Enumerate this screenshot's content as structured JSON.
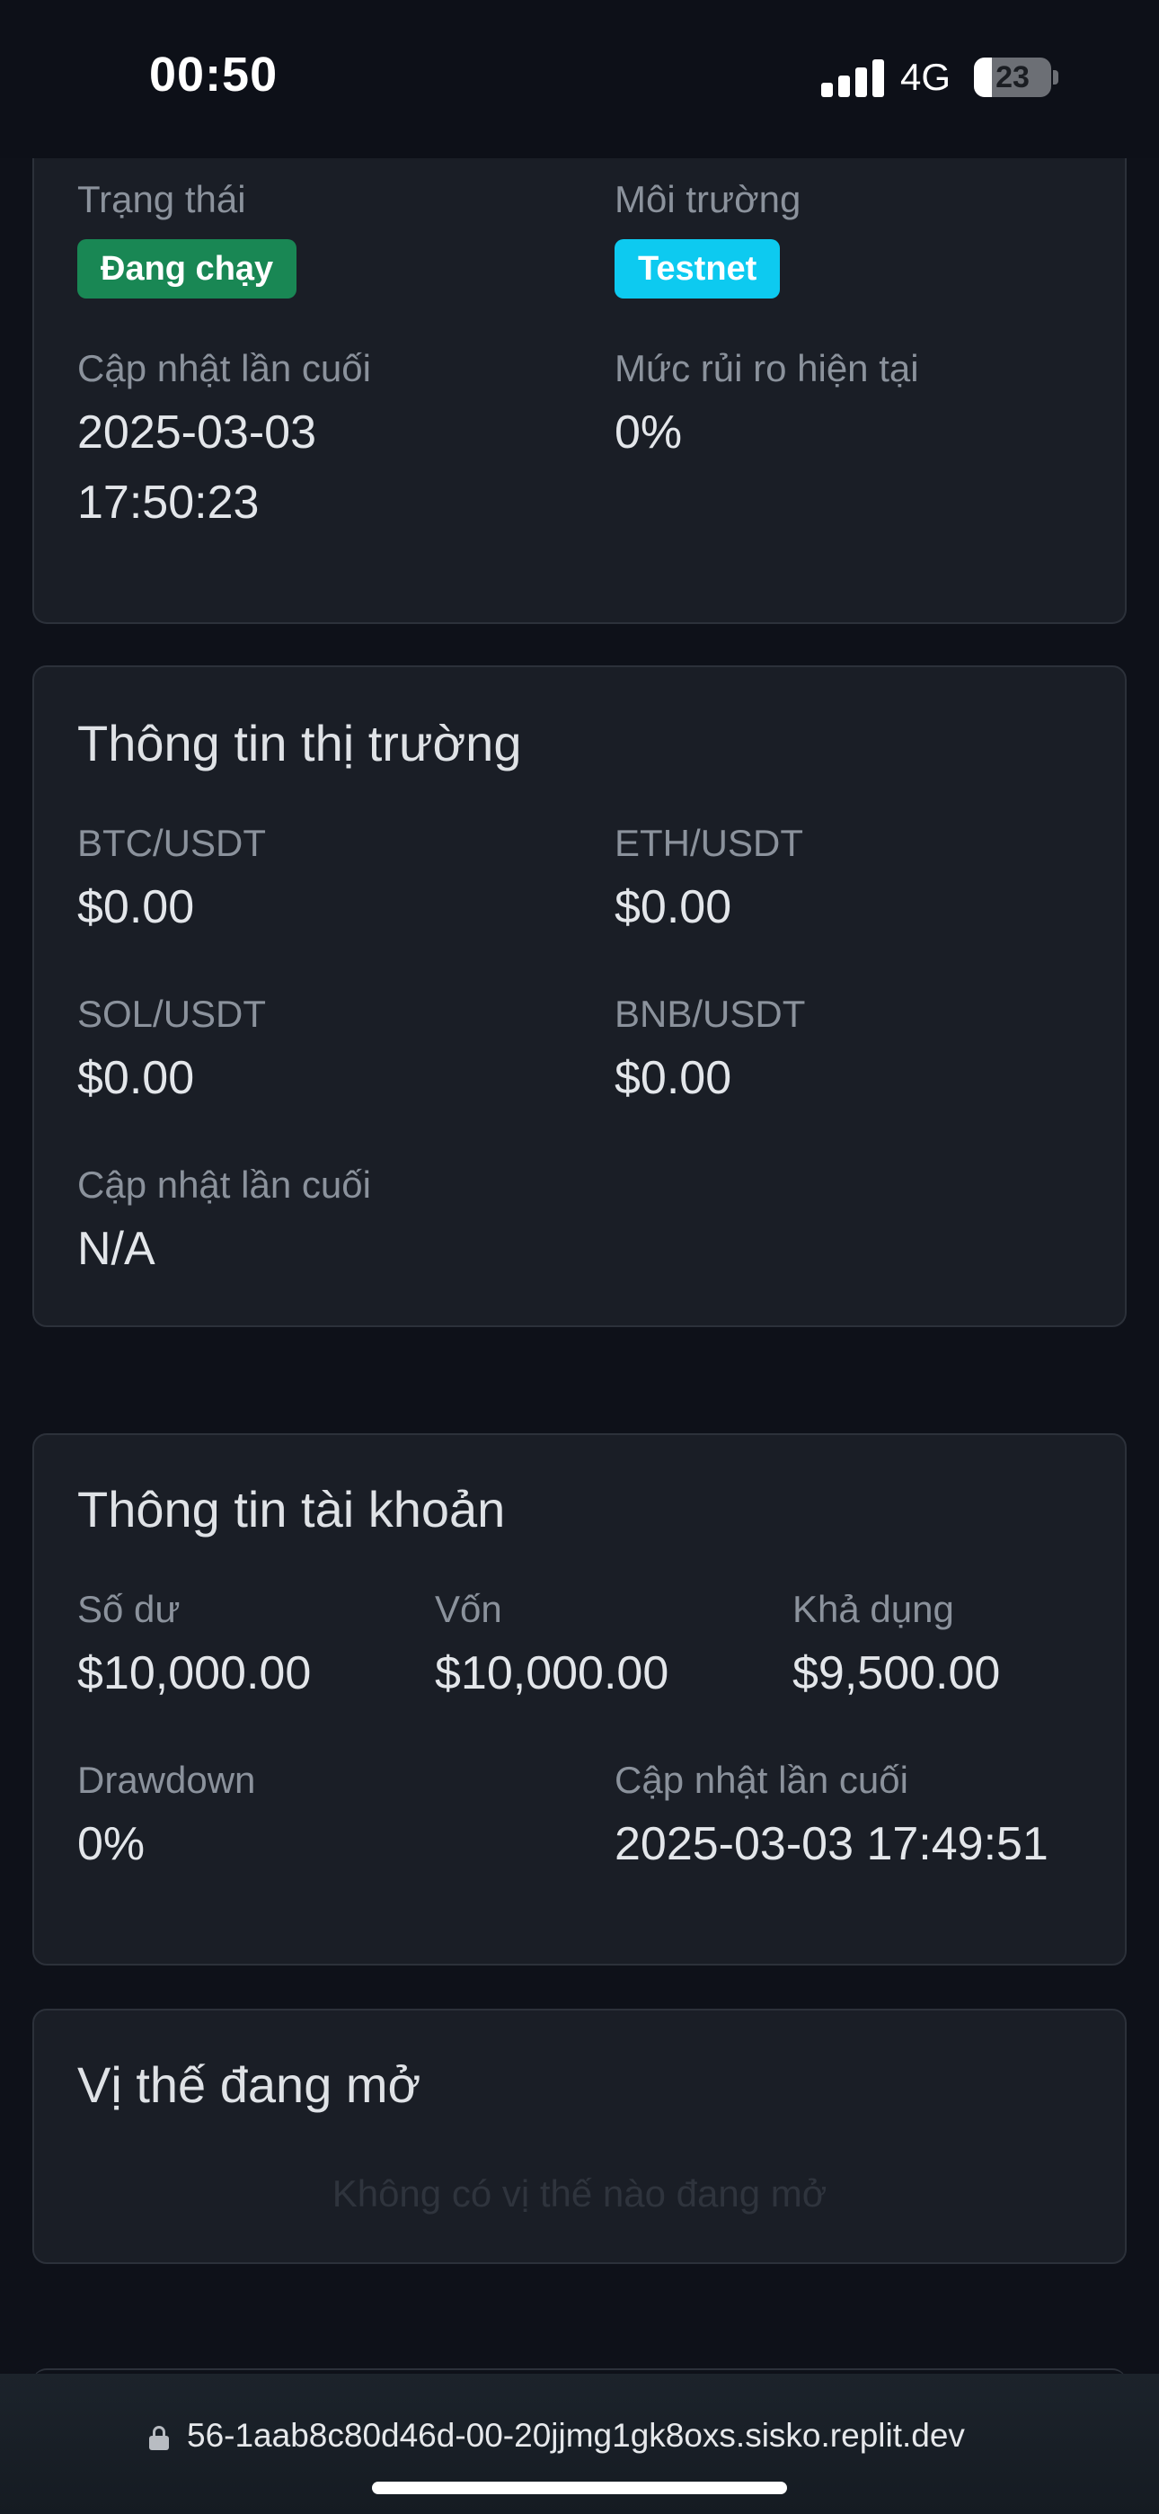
{
  "status_bar": {
    "time": "00:50",
    "network": "4G",
    "battery": "23",
    "battery_level": 0.23,
    "icons": [
      "signal-icon",
      "battery-icon"
    ]
  },
  "bot_status": {
    "status_label": "Trạng thái",
    "status_badge": "Đang chạy",
    "env_label": "Môi trường",
    "env_badge": "Testnet",
    "updated_label": "Cập nhật lần cuối",
    "updated_date": "2025-03-03",
    "updated_time": "17:50:23",
    "risk_label": "Mức rủi ro hiện tại",
    "risk_value": "0%",
    "colors": {
      "running": "#198754",
      "testnet": "#0dcaf0"
    }
  },
  "market": {
    "title": "Thông tin thị trường",
    "pairs": [
      {
        "symbol": "BTC/USDT",
        "price": "$0.00"
      },
      {
        "symbol": "ETH/USDT",
        "price": "$0.00"
      },
      {
        "symbol": "SOL/USDT",
        "price": "$0.00"
      },
      {
        "symbol": "BNB/USDT",
        "price": "$0.00"
      }
    ],
    "updated_label": "Cập nhật lần cuối",
    "updated_value": "N/A"
  },
  "account": {
    "title": "Thông tin tài khoản",
    "balance_label": "Số dư",
    "balance_value": "$10,000.00",
    "equity_label": "Vốn",
    "equity_value": "$10,000.00",
    "available_label": "Khả dụng",
    "available_value": "$9,500.00",
    "drawdown_label": "Drawdown",
    "drawdown_value": "0%",
    "updated_label": "Cập nhật lần cuối",
    "updated_value": "2025-03-03 17:49:51"
  },
  "positions": {
    "title": "Vị thế đang mở",
    "empty_message": "Không có vị thế nào đang mở"
  },
  "browser": {
    "url": "56-1aab8c80d46d-00-20jjmg1gk8oxs.sisko.replit.dev"
  }
}
